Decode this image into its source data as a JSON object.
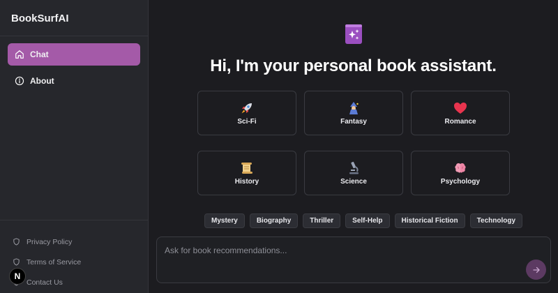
{
  "app": {
    "title": "BookSurfAI"
  },
  "sidebar": {
    "items": [
      {
        "label": "Chat",
        "icon": "home-icon",
        "active": true
      },
      {
        "label": "About",
        "icon": "info-icon",
        "active": false
      }
    ],
    "footer": [
      {
        "label": "Privacy Policy",
        "icon": "shield-icon"
      },
      {
        "label": "Terms of Service",
        "icon": "shield-icon"
      },
      {
        "label": "Contact Us",
        "icon": "shield-icon"
      }
    ],
    "badge": "N"
  },
  "main": {
    "hero_icon": "sparkle-book-icon",
    "greeting": "Hi, I'm your personal book assistant.",
    "genres": [
      {
        "label": "Sci-Fi",
        "icon": "rocket-icon"
      },
      {
        "label": "Fantasy",
        "icon": "mage-icon"
      },
      {
        "label": "Romance",
        "icon": "heart-icon"
      },
      {
        "label": "History",
        "icon": "scroll-icon"
      },
      {
        "label": "Science",
        "icon": "microscope-icon"
      },
      {
        "label": "Psychology",
        "icon": "brain-icon"
      }
    ],
    "chips": [
      "Mystery",
      "Biography",
      "Thriller",
      "Self-Help",
      "Historical Fiction",
      "Technology"
    ],
    "prompt": {
      "placeholder": "Ask for book recommendations...",
      "value": ""
    }
  },
  "colors": {
    "accent": "#a45aa8",
    "send_button": "#5c3a62",
    "background": "#1c1c20",
    "sidebar": "#26272c"
  }
}
